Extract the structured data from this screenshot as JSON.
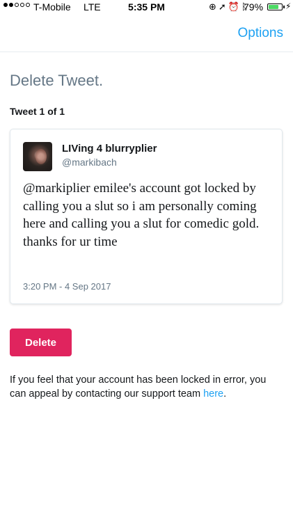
{
  "status_bar": {
    "carrier": "T-Mobile",
    "network": "LTE",
    "time": "5:35 PM",
    "battery": "79%",
    "battery_level": 0.79,
    "icons": [
      "lock-rotation-icon",
      "location-arrow-icon",
      "alarm-icon",
      "bluetooth-icon",
      "charging-icon"
    ]
  },
  "nav": {
    "options_label": "Options"
  },
  "page_title": "Delete Tweet.",
  "tweet_count": "Tweet 1 of 1",
  "tweet": {
    "display_name": "LIVing 4 blurryplier",
    "handle": "@markibach",
    "text": "@markiplier emilee's account got locked by calling you a slut so i am personally coming here and calling you a slut for comedic gold. thanks for ur time",
    "timestamp": "3:20 PM - 4 Sep 2017"
  },
  "delete_label": "Delete",
  "appeal": {
    "text": "If you feel that your account has been locked in error, you can appeal by contacting our support team ",
    "link_text": "here",
    "end": "."
  },
  "colors": {
    "accent": "#1da1f2",
    "delete": "#e0245e",
    "muted": "#657786"
  }
}
